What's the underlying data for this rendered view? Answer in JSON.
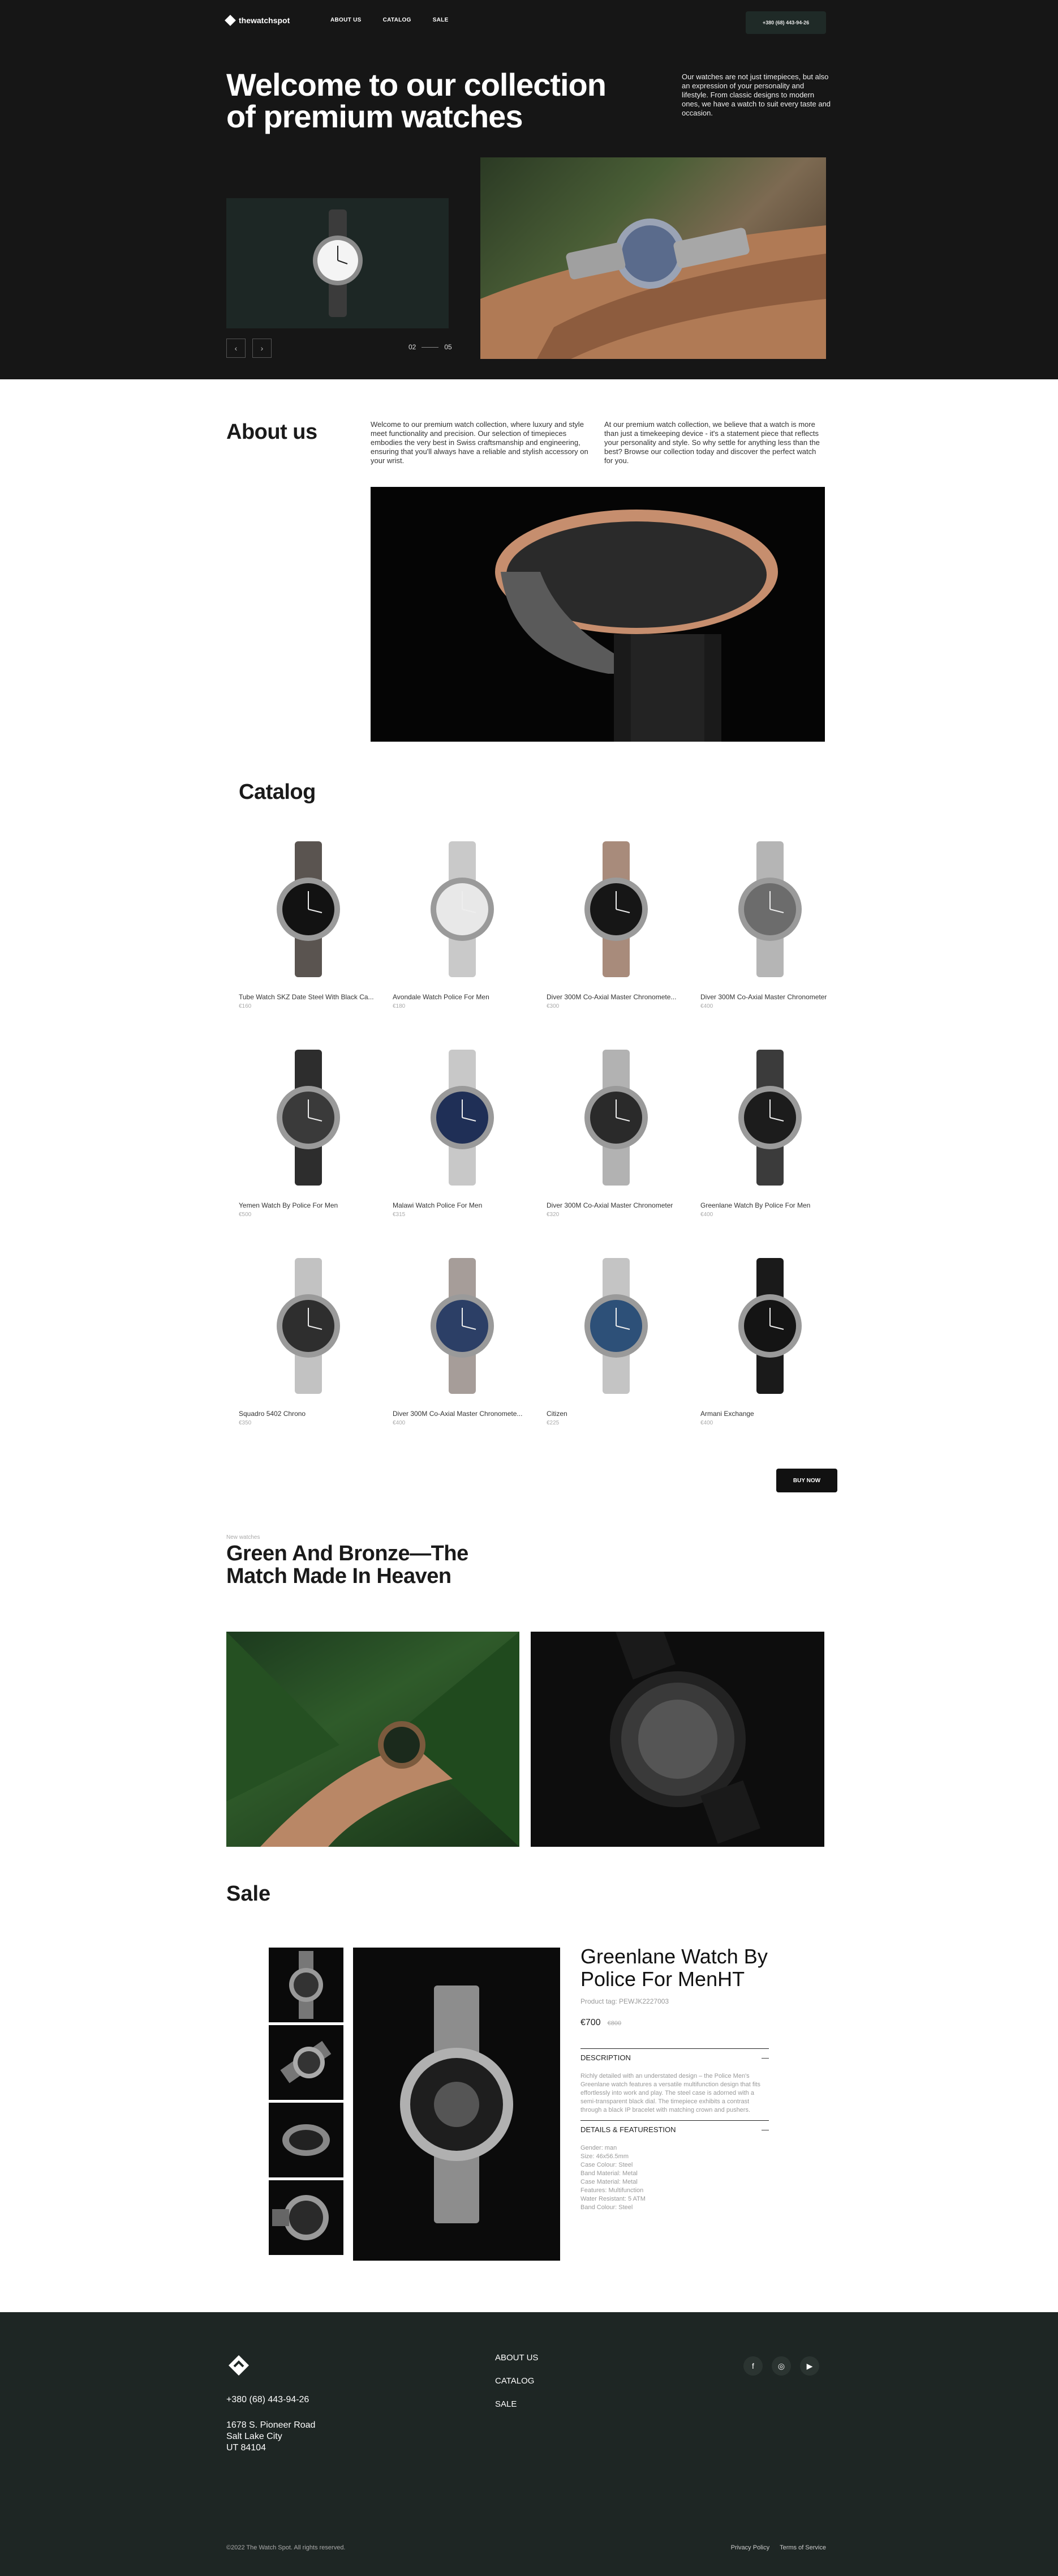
{
  "nav": {
    "brand": "thewatchspot",
    "links": [
      "ABOUT US",
      "CATALOG",
      "SALE"
    ],
    "phone": "+380 (68) 443-94-26"
  },
  "hero": {
    "title": "Welcome to our collection of premium watches",
    "copy": "Our watches are not just timepieces, but also an expression of your personality and lifestyle. From classic designs to modern ones, we have a watch to suit every taste and occasion.",
    "slide_current": "02",
    "slide_total": "05",
    "prev_icon": "chevron-left-icon",
    "next_icon": "chevron-right-icon"
  },
  "about": {
    "title": "About us",
    "paragraph_1": "Welcome to our premium watch collection, where luxury and style meet functionality and precision. Our selection of timepieces embodies the very best in Swiss craftsmanship and engineering, ensuring that you'll always have a reliable and stylish accessory on your wrist.",
    "paragraph_2": "At our premium watch collection, we believe that a watch is more than just a timekeeping device - it's a statement piece that reflects your personality and style. So why settle for anything less than the best? Browse our collection today and discover the perfect watch for you."
  },
  "catalog": {
    "title": "Catalog",
    "products": [
      {
        "name": "Tube Watch SKZ Date Steel With Black Ca...",
        "price": "€160"
      },
      {
        "name": "Avondale Watch Police For Men",
        "price": "€180"
      },
      {
        "name": "Diver 300M Co-Axial Master Chronomete...",
        "price": "€300"
      },
      {
        "name": "Diver 300M Co-Axial Master Chronometer",
        "price": "€400"
      },
      {
        "name": "Yemen Watch By Police For Men",
        "price": "€500"
      },
      {
        "name": "Malawi Watch Police For Men",
        "price": "€315"
      },
      {
        "name": "Diver 300M Co-Axial Master Chronometer",
        "price": "€320"
      },
      {
        "name": "Greenlane Watch By Police For Men",
        "price": "€400"
      },
      {
        "name": "Squadro 5402 Chrono",
        "price": "€350"
      },
      {
        "name": "Diver 300M Co-Axial Master Chronomete...",
        "price": "€400"
      },
      {
        "name": "Citizen",
        "price": "€225"
      },
      {
        "name": "Armani Exchange",
        "price": "€400"
      }
    ],
    "buy_now": "BUY NOW"
  },
  "promo": {
    "kicker": "New watches",
    "title": "Green And Bronze—The Match Made In Heaven"
  },
  "sale": {
    "title": "Sale",
    "product_name": "Greenlane Watch By Police For MenHT",
    "product_tag": "Product tag: PEWJK2227003",
    "price": "€700",
    "old_price": "€800",
    "description_label": "DESCRIPTION",
    "description_text": "Richly detailed with an understated design – the Police Men's Greenlane watch features a versatile multifunction design that fits effortlessly into work and play. The steel case is adorned with a semi-transparent black dial. The timepiece exhibits a contrast through a black IP bracelet with matching crown and pushers.",
    "details_label": "DETAILS & FEATURESTION",
    "specs": [
      "Gender: man",
      "Size: 46x56.5mm",
      "Case Colour: Steel",
      "Band Material: Metal",
      "Case Material: Metal",
      "Features: Multifunction",
      "Water Resistant: 5 ATM",
      "Band Colour: Steel"
    ],
    "toggle_symbol": "—"
  },
  "footer": {
    "phone": "+380 (68) 443-94-26",
    "address_line_1": "1678 S. Pioneer Road",
    "address_line_2": "Salt Lake City",
    "address_line_3": "UT 84104",
    "links": [
      "ABOUT US",
      "CATALOG",
      "SALE"
    ],
    "social": [
      "facebook-icon",
      "instagram-icon",
      "youtube-icon"
    ],
    "copyright": "©2022 The Watch Spot. All rights reserved.",
    "privacy": "Privacy Policy",
    "terms": "Terms of Service"
  }
}
